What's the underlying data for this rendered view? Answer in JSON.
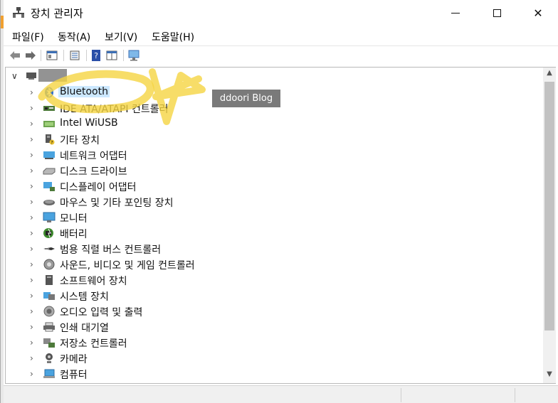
{
  "window": {
    "title": "장치 관리자",
    "controls": {
      "minimize": "minimize",
      "maximize": "maximize",
      "close": "✕"
    }
  },
  "menu": [
    {
      "label": "파일(F)"
    },
    {
      "label": "동작(A)"
    },
    {
      "label": "보기(V)"
    },
    {
      "label": "도움말(H)"
    }
  ],
  "toolbar": {
    "icons": [
      "back-arrow-icon",
      "forward-arrow-icon",
      "properties-pane-icon",
      "device-properties-icon",
      "help-icon",
      "view-grid-icon",
      "monitor-scan-icon"
    ]
  },
  "tree": {
    "root_label_redacted": true,
    "items": [
      {
        "label": "Bluetooth",
        "icon": "bluetooth-icon",
        "selected": true
      },
      {
        "label": "IDE ATA/ATAPI 컨트롤러",
        "icon": "ide-controller-icon"
      },
      {
        "label": "Intel WiUSB",
        "icon": "usb-device-icon"
      },
      {
        "label": "기타 장치",
        "icon": "other-device-icon"
      },
      {
        "label": "네트워크 어댑터",
        "icon": "network-adapter-icon"
      },
      {
        "label": "디스크 드라이브",
        "icon": "disk-drive-icon"
      },
      {
        "label": "디스플레이 어댑터",
        "icon": "display-adapter-icon"
      },
      {
        "label": "마우스 및 기타 포인팅 장치",
        "icon": "mouse-icon"
      },
      {
        "label": "모니터",
        "icon": "monitor-icon"
      },
      {
        "label": "배터리",
        "icon": "battery-icon"
      },
      {
        "label": "범용 직렬 버스 컨트롤러",
        "icon": "usb-controller-icon"
      },
      {
        "label": "사운드, 비디오 및 게임 컨트롤러",
        "icon": "sound-icon"
      },
      {
        "label": "소프트웨어 장치",
        "icon": "software-device-icon"
      },
      {
        "label": "시스템 장치",
        "icon": "system-device-icon"
      },
      {
        "label": "오디오 입력 및 출력",
        "icon": "audio-io-icon"
      },
      {
        "label": "인쇄 대기열",
        "icon": "print-queue-icon"
      },
      {
        "label": "저장소 컨트롤러",
        "icon": "storage-controller-icon"
      },
      {
        "label": "카메라",
        "icon": "camera-icon"
      },
      {
        "label": "컴퓨터",
        "icon": "computer-icon"
      }
    ]
  },
  "overlay": {
    "watermark": "ddoori Blog"
  },
  "colors": {
    "selection": "#cce8ff",
    "scribble": "#f5d442",
    "watermark_bg": "#7a7a7a"
  }
}
